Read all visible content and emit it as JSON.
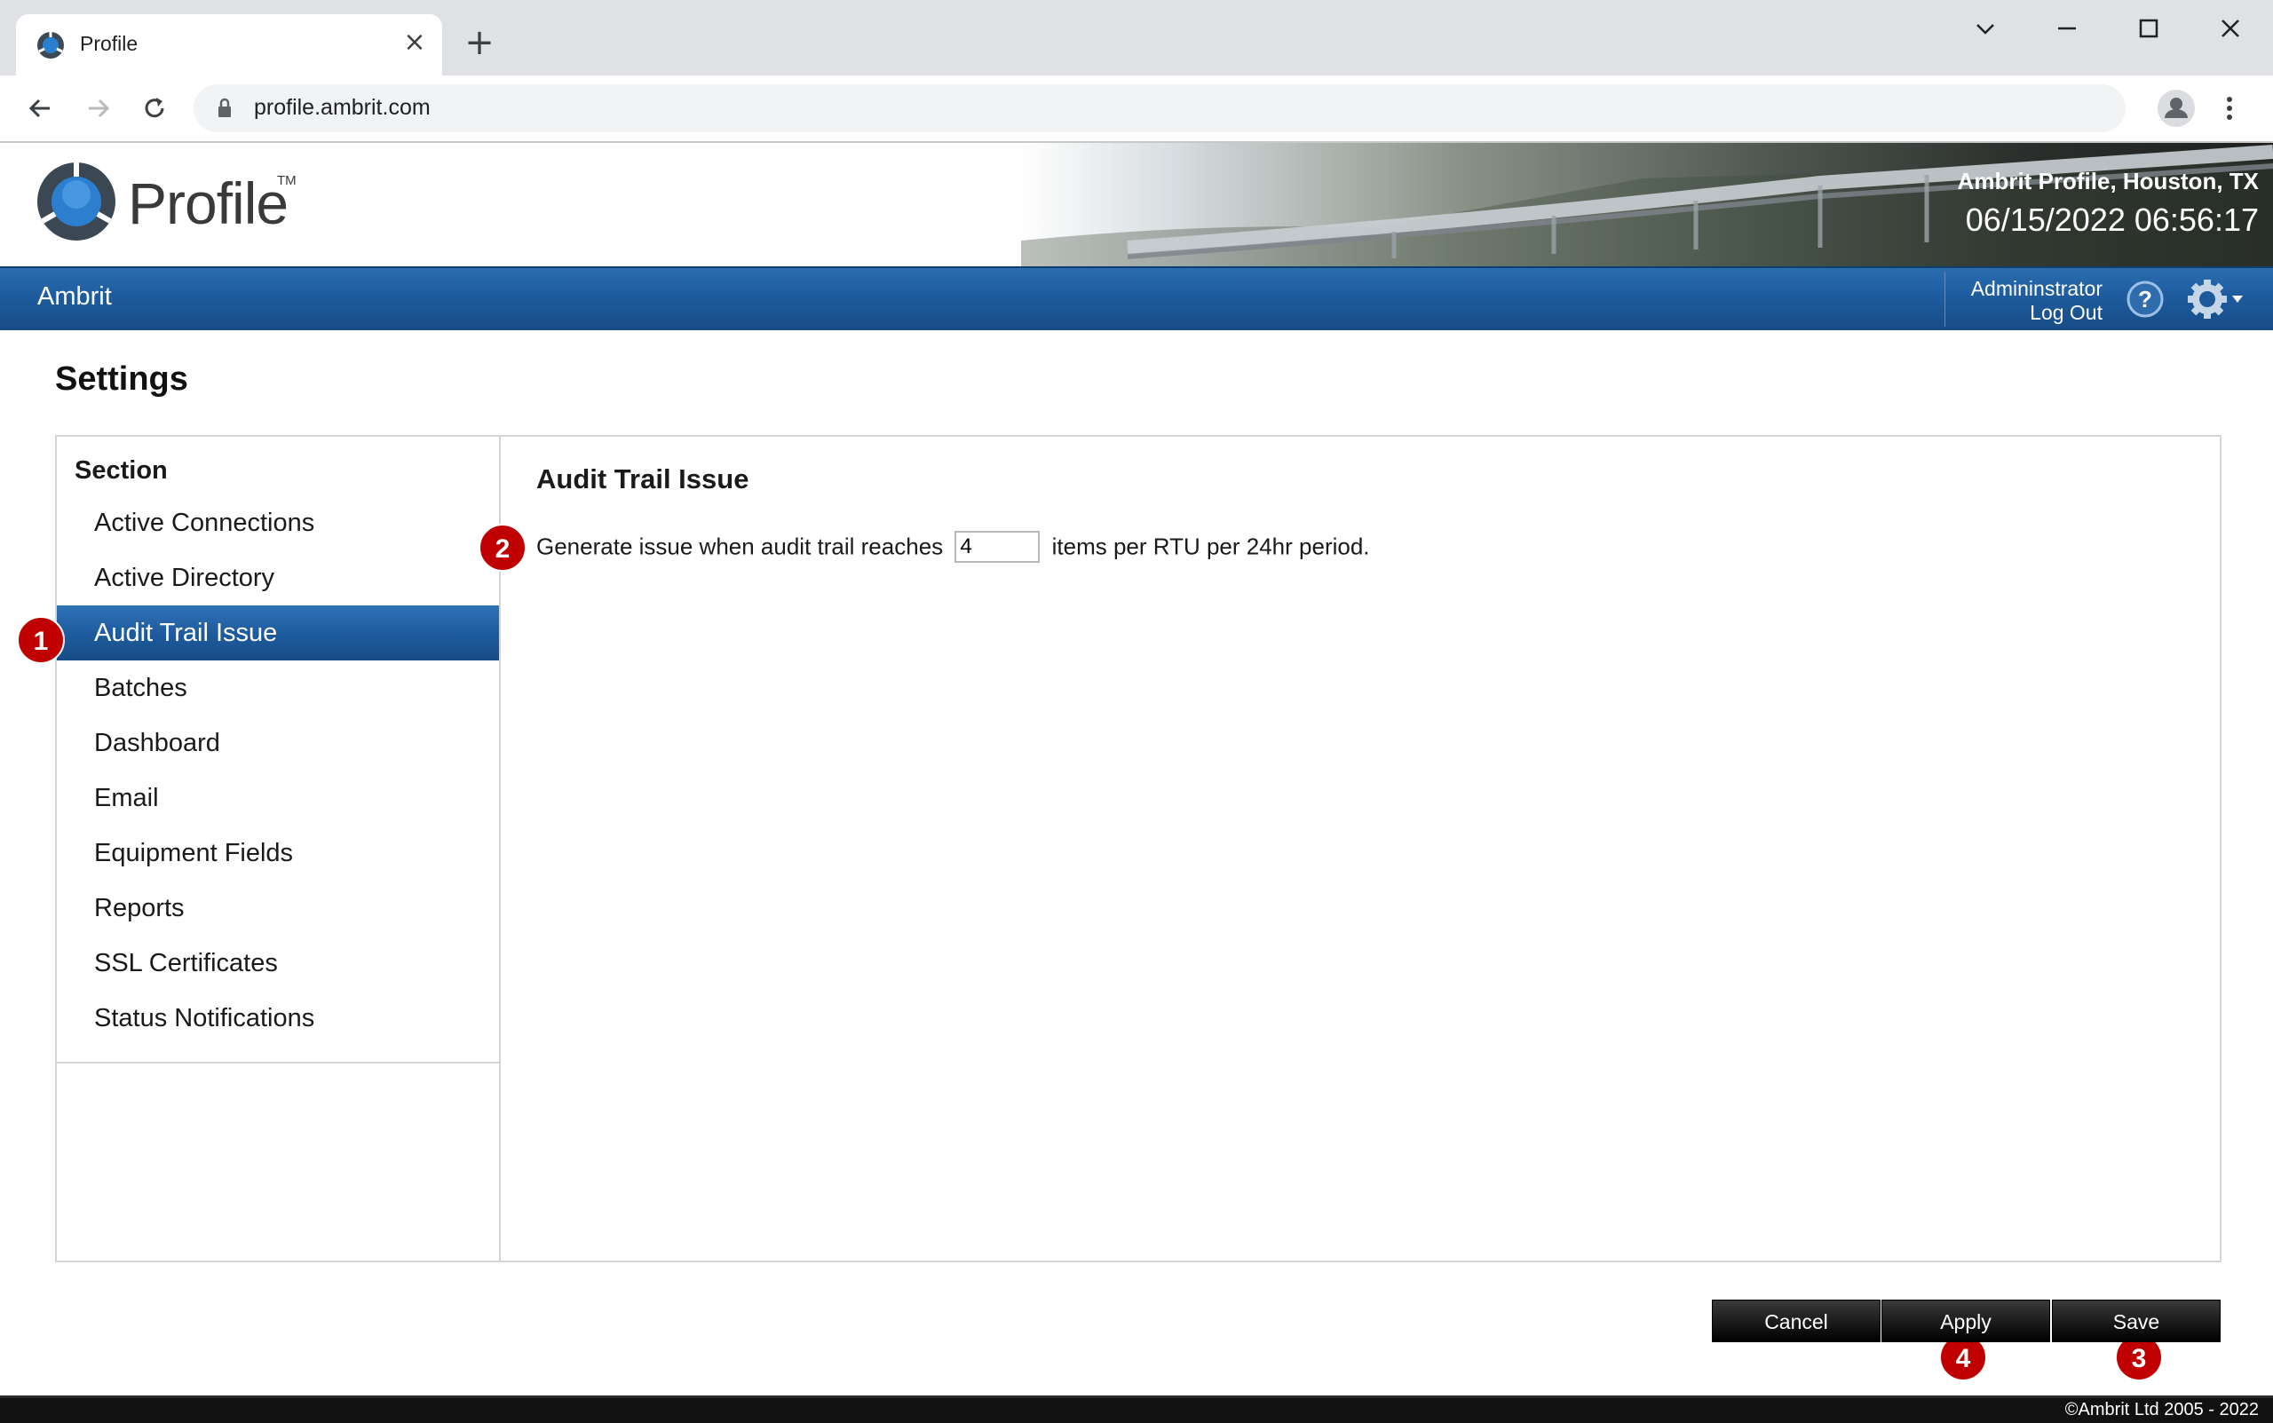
{
  "browser": {
    "tab_title": "Profile",
    "tab_close_icon": "close-icon",
    "new_tab_icon": "plus-icon",
    "url": "profile.ambrit.com"
  },
  "header": {
    "logo_text": "Profile",
    "logo_tm": "TM",
    "site_name": "Ambrit Profile, Houston, TX",
    "clock": "06/15/2022 06:56:17"
  },
  "nav": {
    "company": "Ambrit",
    "user": "Admininstrator",
    "logout": "Log Out"
  },
  "page": {
    "title": "Settings"
  },
  "sidebar": {
    "heading": "Section",
    "items": [
      {
        "label": "Active Connections"
      },
      {
        "label": "Active Directory"
      },
      {
        "label": "Audit Trail Issue"
      },
      {
        "label": "Batches"
      },
      {
        "label": "Dashboard"
      },
      {
        "label": "Email"
      },
      {
        "label": "Equipment Fields"
      },
      {
        "label": "Reports"
      },
      {
        "label": "SSL Certificates"
      },
      {
        "label": "Status Notifications"
      }
    ],
    "selected": "Audit Trail Issue"
  },
  "content": {
    "title": "Audit Trail Issue",
    "prefix": "Generate issue when audit trail reaches",
    "value": "4",
    "suffix": "items per RTU per 24hr period."
  },
  "buttons": {
    "cancel": "Cancel",
    "apply": "Apply",
    "save": "Save"
  },
  "badges": {
    "b1": "1",
    "b2": "2",
    "b3": "3",
    "b4": "4"
  },
  "footer": {
    "copyright": "©Ambrit Ltd 2005 - 2022"
  },
  "colors": {
    "accent_blue": "#1d5a9c",
    "badge_red": "#c00000",
    "button_black": "#1a1a1a"
  }
}
